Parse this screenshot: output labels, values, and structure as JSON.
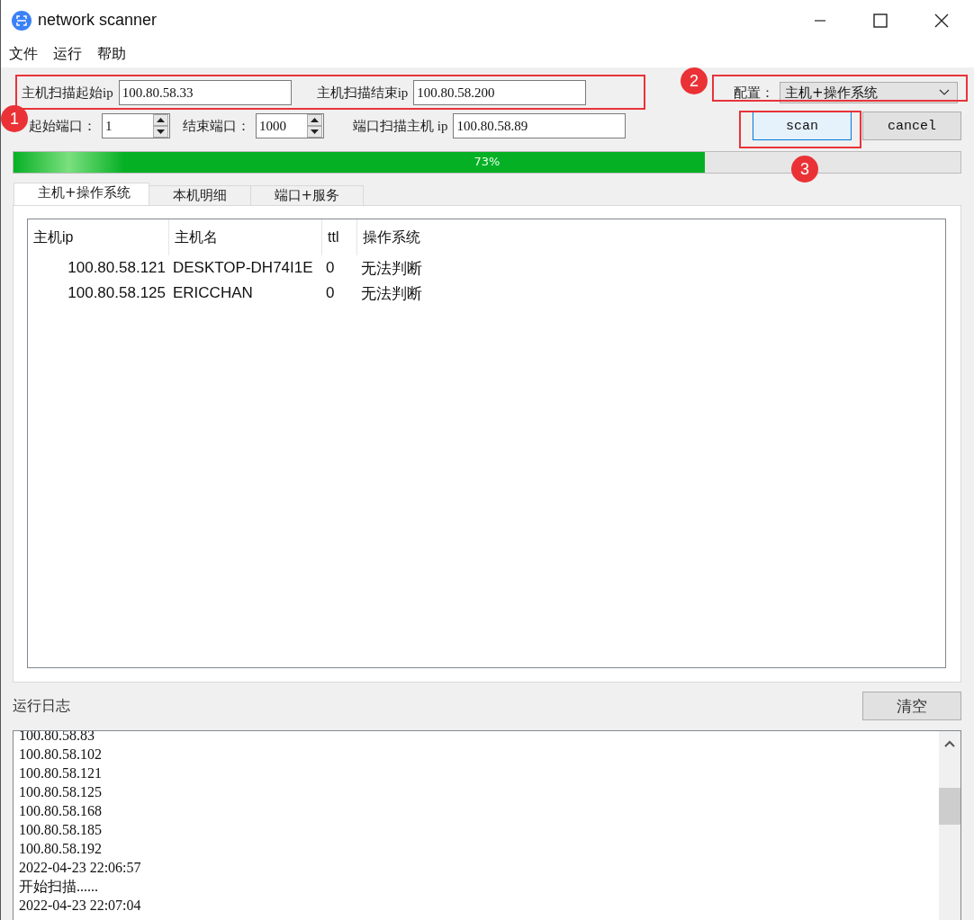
{
  "window": {
    "title": "network scanner"
  },
  "menu": [
    "文件",
    "运行",
    "帮助"
  ],
  "host_scan": {
    "start_label": "主机扫描起始ip",
    "start_value": "100.80.58.33",
    "end_label": "主机扫描结束ip",
    "end_value": "100.80.58.200"
  },
  "config": {
    "label": "配置：",
    "value": "主机+操作系统"
  },
  "port_scan": {
    "start_label": "起始端口：",
    "start_value": "1",
    "end_label": "结束端口：",
    "end_value": "1000",
    "host_label": "端口扫描主机 ip",
    "host_value": "100.80.58.89"
  },
  "buttons": [
    {
      "label": "scan",
      "focused": true
    },
    {
      "label": "cancel",
      "focused": false
    }
  ],
  "progress": {
    "level": 0.73,
    "reading": "73%"
  },
  "tabs": [
    {
      "label": "主机+操作系统",
      "selected": true
    },
    {
      "label": "本机明细",
      "selected": false
    },
    {
      "label": "端口+服务",
      "selected": false
    }
  ],
  "table": {
    "columns": [
      "主机ip",
      "主机名",
      "ttl",
      "操作系统"
    ],
    "rows": [
      [
        "100.80.58.121",
        "DESKTOP-DH74I1E",
        "0",
        "无法判断"
      ],
      [
        "100.80.58.125",
        "ERICCHAN",
        "0",
        "无法判断"
      ]
    ]
  },
  "log": {
    "label": "运行日志",
    "clear_button": "清空",
    "lines": [
      "100.80.58.83",
      "100.80.58.102",
      "100.80.58.121",
      "100.80.58.125",
      "100.80.58.168",
      "100.80.58.185",
      "100.80.58.192",
      "2022-04-23 22:06:57",
      "开始扫描......",
      "2022-04-23 22:07:04"
    ]
  },
  "annotations": [
    {
      "number": "1"
    },
    {
      "number": "2"
    },
    {
      "number": "3"
    }
  ]
}
